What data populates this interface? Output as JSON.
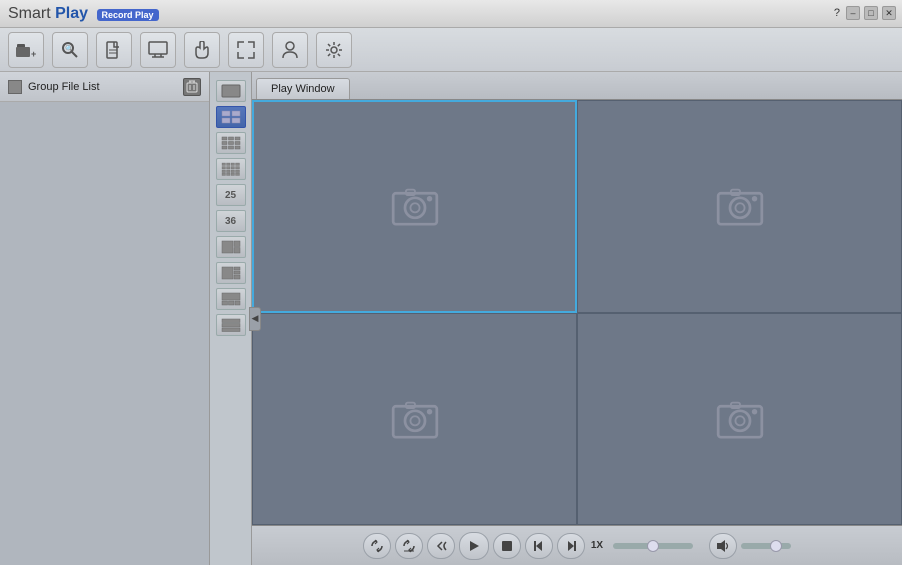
{
  "app": {
    "title_smart": "Smart",
    "title_play": "Play",
    "subtitle": "Record Play"
  },
  "titlebar": {
    "help": "?",
    "minimize": "–",
    "maximize": "□",
    "close": "✕"
  },
  "toolbar": {
    "buttons": [
      {
        "name": "add-file-btn",
        "icon": "📂",
        "tooltip": "Add File"
      },
      {
        "name": "search-btn",
        "icon": "🔍",
        "tooltip": "Search"
      },
      {
        "name": "file-btn",
        "icon": "📄",
        "tooltip": "File"
      },
      {
        "name": "monitor-btn",
        "icon": "🖥",
        "tooltip": "Monitor"
      },
      {
        "name": "hand-btn",
        "icon": "✋",
        "tooltip": "Pan"
      },
      {
        "name": "resize-btn",
        "icon": "⤢",
        "tooltip": "Resize"
      },
      {
        "name": "person-btn",
        "icon": "👤",
        "tooltip": "Person"
      },
      {
        "name": "settings-btn",
        "icon": "⚙",
        "tooltip": "Settings"
      }
    ]
  },
  "sidebar": {
    "group_file_label": "Group File List",
    "delete_icon": "🗑"
  },
  "layout_panel": {
    "buttons": [
      {
        "name": "layout-1x1",
        "label": "▬",
        "active": false
      },
      {
        "name": "layout-2x2",
        "label": "⊞",
        "active": true
      },
      {
        "name": "layout-3x3",
        "label": "⠿",
        "active": false
      },
      {
        "name": "layout-4x4",
        "label": "⠿",
        "active": false
      },
      {
        "name": "layout-25",
        "label": "25",
        "active": false
      },
      {
        "name": "layout-36",
        "label": "36",
        "active": false
      },
      {
        "name": "layout-custom1",
        "label": "▦",
        "active": false
      },
      {
        "name": "layout-custom2",
        "label": "▦",
        "active": false
      },
      {
        "name": "layout-custom3",
        "label": "▦",
        "active": false
      },
      {
        "name": "layout-custom4",
        "label": "▤",
        "active": false
      }
    ]
  },
  "play_window": {
    "tab_label": "Play Window",
    "cells": [
      {
        "id": 1,
        "selected": true
      },
      {
        "id": 2,
        "selected": false
      },
      {
        "id": 3,
        "selected": false
      },
      {
        "id": 4,
        "selected": false
      }
    ]
  },
  "playback": {
    "btn_sync": "⟳",
    "btn_sync2": "⟳",
    "btn_rewind": "↩",
    "btn_play": "▶",
    "btn_stop": "■",
    "btn_prev_frame": "◀|",
    "btn_next_frame": "|▶",
    "speed_label": "1X",
    "volume_icon": "🔊"
  }
}
